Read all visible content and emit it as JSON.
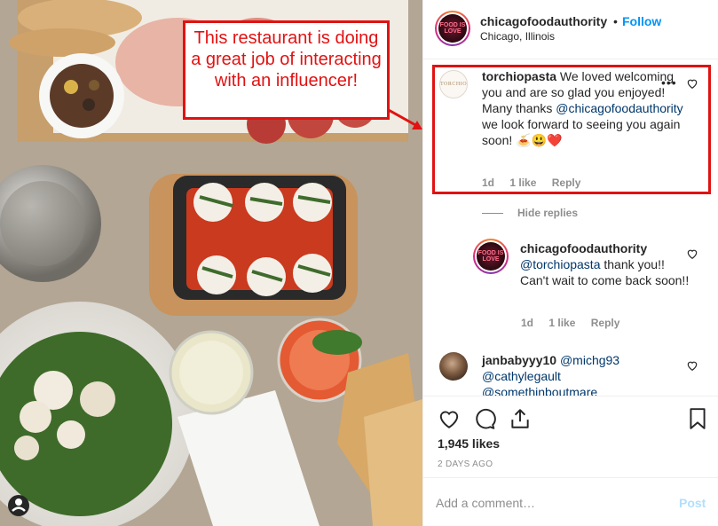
{
  "post": {
    "owner": {
      "username": "chicagofoodauthority",
      "separator": "•",
      "follow_label": "Follow",
      "location": "Chicago, Illinois",
      "avatar_text": "FOOD IS LOVE"
    },
    "annotation": {
      "text": "This restaurant is doing a great job of interacting with an influencer!"
    },
    "comments": [
      {
        "username": "torchiopasta",
        "avatar_text": "TORCHIO",
        "text": "We loved welcoming you and are so glad you enjoyed! Many thanks",
        "mention": "@chicagofoodauthority",
        "text_after": "we look forward to seeing you again soon! 🍝😃❤️",
        "time": "1d",
        "likes": "1 like",
        "reply_label": "Reply",
        "more_label": "•••"
      },
      {
        "username": "chicagofoodauthority",
        "avatar_text": "FOOD IS LOVE",
        "mention": "@torchiopasta",
        "text": "thank you!! Can't wait to come back soon!!",
        "time": "1d",
        "likes": "1 like",
        "reply_label": "Reply"
      },
      {
        "username": "janbabyyy10",
        "mention": "@michg93",
        "mention2": "@cathylegault",
        "mention3": "@somethinboutmare"
      }
    ],
    "hide_replies_label": "Hide replies",
    "likes_count": "1,945 likes",
    "posted_ago": "2 DAYS AGO",
    "comment_placeholder": "Add a comment…",
    "post_label": "Post",
    "colors": {
      "accent": "#0095f6",
      "annotation": "#e11212",
      "muted": "#8e8e8e"
    }
  }
}
